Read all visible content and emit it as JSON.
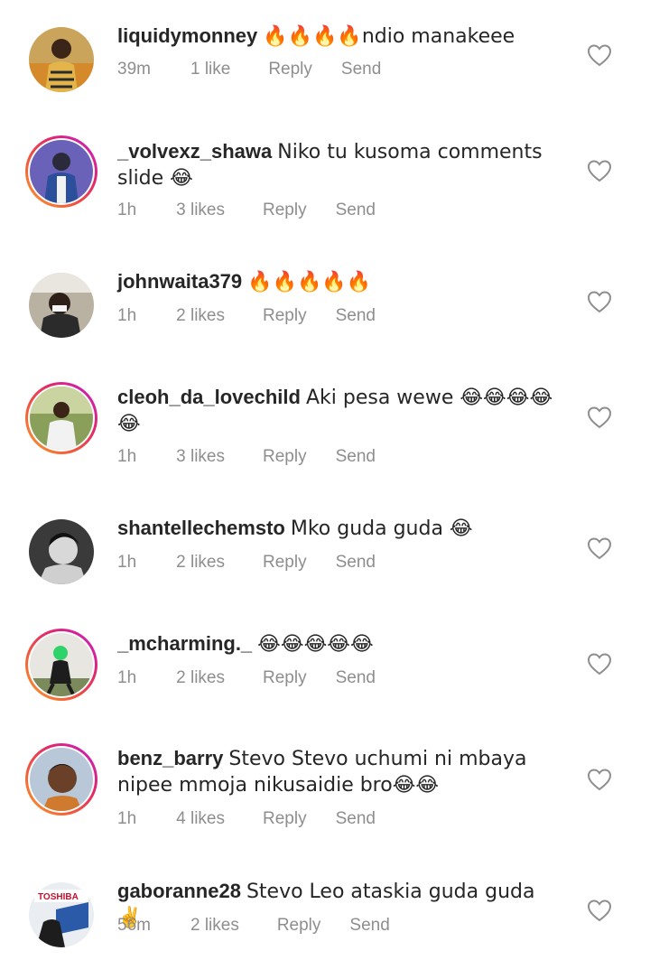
{
  "comments": [
    {
      "username": "liquidymonney",
      "text": "🔥🔥🔥🔥ndio manakeee",
      "time": "39m",
      "likes": "1 like",
      "reply": "Reply",
      "send": "Send",
      "story_ring": false
    },
    {
      "username": "_volvexz_shawa",
      "text": "Niko tu kusoma comments slide 😂",
      "time": "1h",
      "likes": "3 likes",
      "reply": "Reply",
      "send": "Send",
      "story_ring": true
    },
    {
      "username": "johnwaita379",
      "text": "🔥🔥🔥🔥🔥",
      "time": "1h",
      "likes": "2 likes",
      "reply": "Reply",
      "send": "Send",
      "story_ring": false
    },
    {
      "username": "cleoh_da_lovechild",
      "text": "Aki pesa wewe 😂😂😂😂😂",
      "time": "1h",
      "likes": "3 likes",
      "reply": "Reply",
      "send": "Send",
      "story_ring": true
    },
    {
      "username": "shantellechemsto",
      "text": "Mko guda guda 😂",
      "time": "1h",
      "likes": "2 likes",
      "reply": "Reply",
      "send": "Send",
      "story_ring": false
    },
    {
      "username": "_mcharming._",
      "text": "😂😂😂😂😂",
      "time": "1h",
      "likes": "2 likes",
      "reply": "Reply",
      "send": "Send",
      "story_ring": true
    },
    {
      "username": "benz_barry",
      "text": "Stevo Stevo uchumi ni mbaya nipee mmoja nikusaidie bro😂😂",
      "time": "1h",
      "likes": "4 likes",
      "reply": "Reply",
      "send": "Send",
      "story_ring": true
    },
    {
      "username": "gaboranne28",
      "text": "Stevo Leo ataskia guda guda ✌️",
      "time": "56m",
      "likes": "2 likes",
      "reply": "Reply",
      "send": "Send",
      "story_ring": false
    }
  ],
  "icons": {
    "like": "heart-outline-icon"
  },
  "colors": {
    "text": "#262626",
    "meta": "#8e8e8e",
    "heart": "#8e8e8e"
  }
}
